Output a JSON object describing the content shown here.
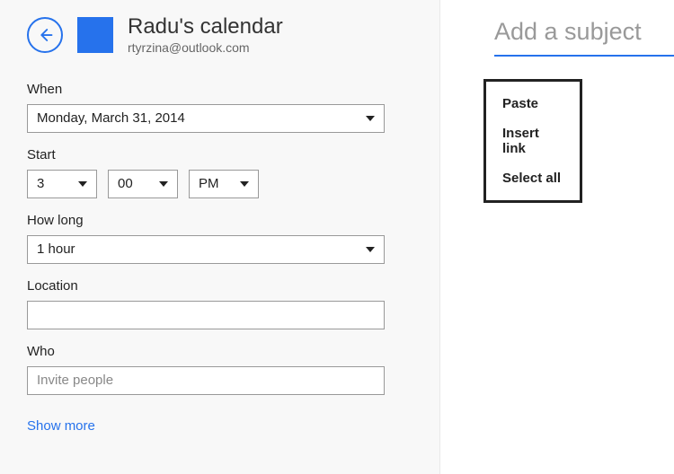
{
  "header": {
    "title": "Radu's calendar",
    "email": "rtyrzina@outlook.com"
  },
  "form": {
    "when_label": "When",
    "when_value": "Monday, March 31, 2014",
    "start_label": "Start",
    "start_hour": "3",
    "start_minute": "00",
    "start_ampm": "PM",
    "howlong_label": "How long",
    "howlong_value": "1 hour",
    "location_label": "Location",
    "location_value": "",
    "who_label": "Who",
    "who_placeholder": "Invite people",
    "show_more": "Show more"
  },
  "right": {
    "subject_placeholder": "Add a subject"
  },
  "context_menu": {
    "paste": "Paste",
    "insert_link": "Insert link",
    "select_all": "Select all"
  }
}
